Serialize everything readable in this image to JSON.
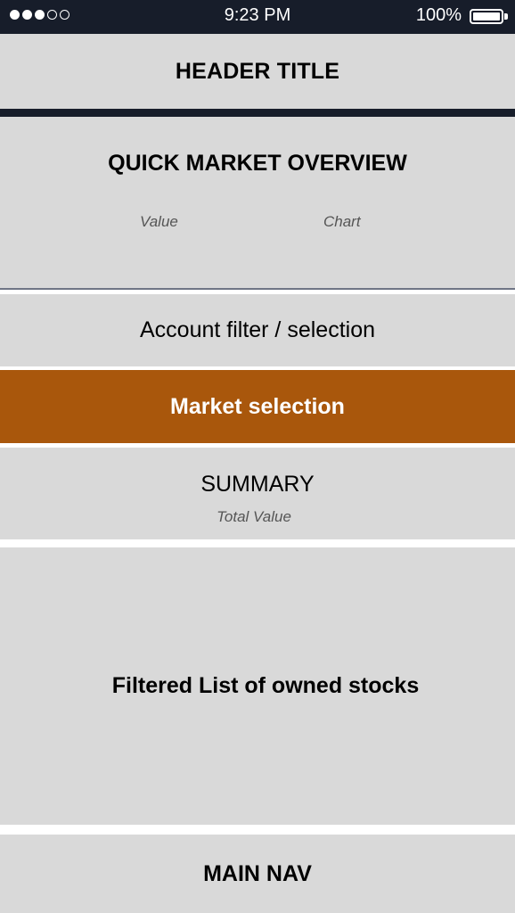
{
  "status_bar": {
    "signal": [
      true,
      true,
      true,
      false,
      false
    ],
    "time": "9:23 PM",
    "battery_percent": "100%"
  },
  "header": {
    "title": "HEADER TITLE"
  },
  "overview": {
    "title": "QUICK MARKET OVERVIEW",
    "value_label": "Value",
    "chart_label": "Chart"
  },
  "account_filter": {
    "label": "Account filter / selection"
  },
  "market_selection": {
    "label": "Market selection",
    "color": "#a9570c"
  },
  "summary": {
    "title": "SUMMARY",
    "subtitle": "Total Value"
  },
  "stock_list": {
    "label": "Filtered List of owned stocks"
  },
  "main_nav": {
    "label": "MAIN NAV"
  },
  "colors": {
    "status_bar": "#171d2a",
    "block": "#d9d9d9",
    "accent": "#a9570c"
  }
}
